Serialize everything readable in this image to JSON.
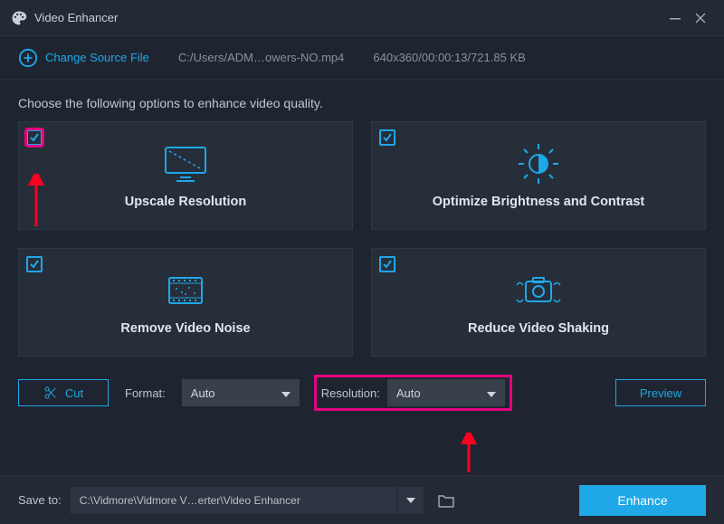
{
  "app": {
    "title": "Video Enhancer"
  },
  "source": {
    "change_label": "Change Source File",
    "path": "C:/Users/ADM…owers-NO.mp4",
    "info": "640x360/00:00:13/721.85 KB"
  },
  "instruction": "Choose the following options to enhance video quality.",
  "options": [
    {
      "label": "Upscale Resolution"
    },
    {
      "label": "Optimize Brightness and Contrast"
    },
    {
      "label": "Remove Video Noise"
    },
    {
      "label": "Reduce Video Shaking"
    }
  ],
  "controls": {
    "cut_label": "Cut",
    "format_label": "Format:",
    "format_value": "Auto",
    "resolution_label": "Resolution:",
    "resolution_value": "Auto",
    "preview_label": "Preview"
  },
  "footer": {
    "save_label": "Save to:",
    "save_path": "C:\\Vidmore\\Vidmore V…erter\\Video Enhancer",
    "enhance_label": "Enhance"
  }
}
